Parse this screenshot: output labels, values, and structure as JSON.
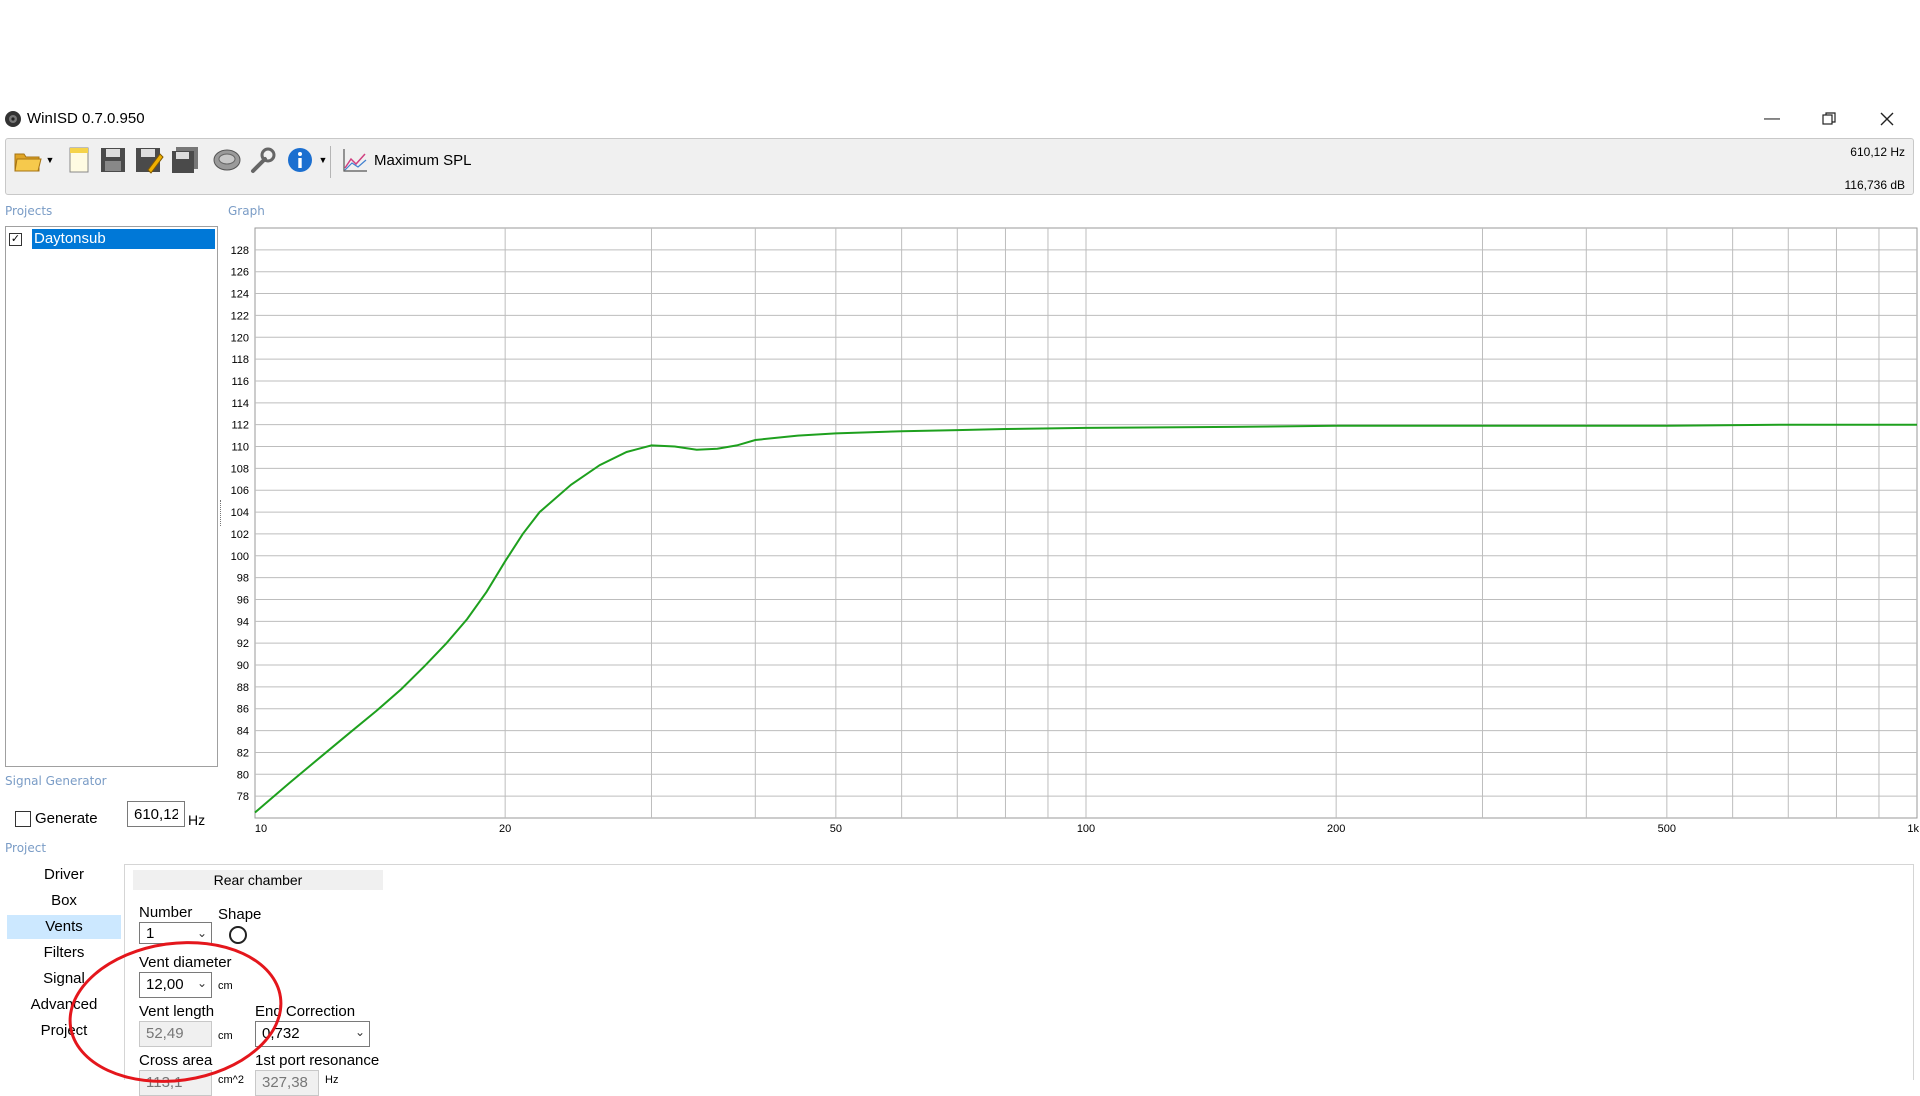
{
  "window": {
    "title": "WinISD 0.7.0.950"
  },
  "toolbar": {
    "icons": [
      "folder-open-icon",
      "new-document-icon",
      "save-icon",
      "save-as-icon",
      "save-all-icon",
      "driver-icon",
      "wrench-icon",
      "info-icon",
      "graph-icon"
    ],
    "graph_label": "Maximum SPL",
    "readout_freq": "610,12 Hz",
    "readout_db": "116,736 dB"
  },
  "projects": {
    "section_label": "Projects",
    "items": [
      {
        "name": "Daytonsub",
        "checked": true
      }
    ]
  },
  "graph": {
    "section_label": "Graph"
  },
  "chart_data": {
    "type": "line",
    "xscale": "log",
    "xlim": [
      10,
      1000
    ],
    "ylim": [
      76,
      130
    ],
    "x_tick_labels": [
      "10",
      "20",
      "50",
      "100",
      "200",
      "500",
      "1k"
    ],
    "x_tick_values": [
      10,
      20,
      50,
      100,
      200,
      500,
      1000
    ],
    "y_ticks": [
      78,
      80,
      82,
      84,
      86,
      88,
      90,
      92,
      94,
      96,
      98,
      100,
      102,
      104,
      106,
      108,
      110,
      112,
      114,
      116,
      118,
      120,
      122,
      124,
      126,
      128
    ],
    "series": [
      {
        "color": "#1ea01e",
        "x": [
          10,
          11,
          12,
          13,
          14,
          15,
          16,
          17,
          18,
          19,
          20,
          21,
          22,
          24,
          26,
          28,
          30,
          32,
          34,
          36,
          38,
          40,
          45,
          50,
          60,
          70,
          80,
          100,
          150,
          200,
          300,
          500,
          700,
          1000
        ],
        "y": [
          76.5,
          79.2,
          81.6,
          83.8,
          85.8,
          87.8,
          89.9,
          92.0,
          94.2,
          96.7,
          99.5,
          102.0,
          104.0,
          106.5,
          108.3,
          109.5,
          110.1,
          110.0,
          109.7,
          109.8,
          110.1,
          110.6,
          111.0,
          111.2,
          111.4,
          111.5,
          111.6,
          111.7,
          111.8,
          111.9,
          111.9,
          111.9,
          112.0,
          112.0
        ]
      }
    ]
  },
  "signal_generator": {
    "section_label": "Signal Generator",
    "generate_label": "Generate",
    "generate_checked": false,
    "frequency_value": "610,12",
    "frequency_unit": "Hz"
  },
  "project_nav": {
    "section_label": "Project",
    "items": [
      "Driver",
      "Box",
      "Vents",
      "Filters",
      "Signal",
      "Advanced",
      "Project"
    ],
    "active": "Vents"
  },
  "vents": {
    "tab_label": "Rear chamber",
    "number_label": "Number",
    "number_value": "1",
    "shape_label": "Shape",
    "vent_diameter_label": "Vent diameter",
    "vent_diameter_value": "12,00",
    "vent_diameter_unit": "cm",
    "vent_length_label": "Vent length",
    "vent_length_value": "52,49",
    "vent_length_unit": "cm",
    "end_correction_label": "End Correction",
    "end_correction_value": "0,732",
    "cross_area_label": "Cross area",
    "cross_area_value": "113,1",
    "cross_area_unit": "cm^2",
    "port_resonance_label": "1st port resonance",
    "port_resonance_value": "327,38",
    "port_resonance_unit": "Hz"
  }
}
